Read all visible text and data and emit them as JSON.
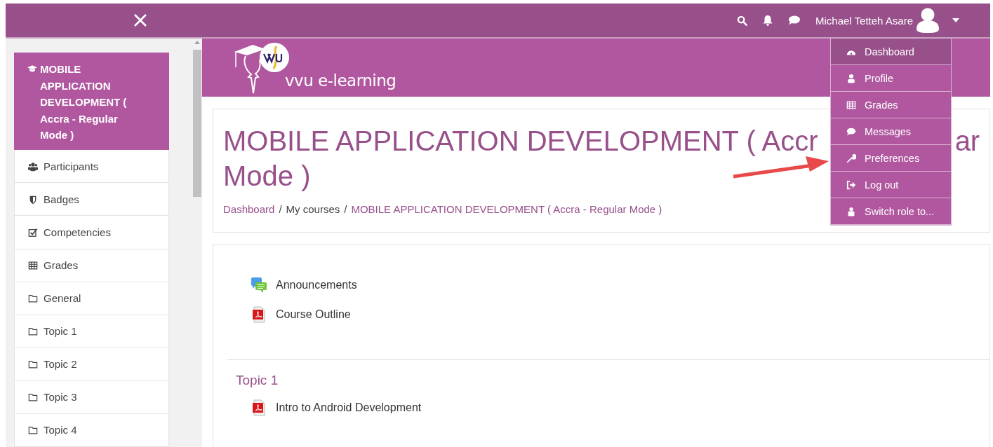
{
  "navbar": {
    "user_name": "Michael Tetteh Asare"
  },
  "user_menu": [
    {
      "label": "Dashboard",
      "kind": "dashboard",
      "selected": true
    },
    {
      "label": "Profile",
      "kind": "user",
      "selected": false
    },
    {
      "label": "Grades",
      "kind": "table",
      "selected": false
    },
    {
      "label": "Messages",
      "kind": "comment",
      "selected": false
    },
    {
      "label": "Preferences",
      "kind": "wrench",
      "selected": false
    },
    {
      "label": "Log out",
      "kind": "logout",
      "selected": false
    },
    {
      "label": "Switch role to...",
      "kind": "role",
      "selected": false
    }
  ],
  "sidebar": {
    "items": [
      {
        "label": "MOBILE APPLICATION DEVELOPMENT ( Accra - Regular Mode )",
        "kind": "course",
        "selected": true
      },
      {
        "label": "Participants",
        "kind": "users",
        "selected": false
      },
      {
        "label": "Badges",
        "kind": "shield",
        "selected": false
      },
      {
        "label": "Competencies",
        "kind": "check",
        "selected": false
      },
      {
        "label": "Grades",
        "kind": "table",
        "selected": false
      },
      {
        "label": "General",
        "kind": "folder",
        "selected": false
      },
      {
        "label": "Topic 1",
        "kind": "folder",
        "selected": false
      },
      {
        "label": "Topic 2",
        "kind": "folder",
        "selected": false
      },
      {
        "label": "Topic 3",
        "kind": "folder",
        "selected": false
      },
      {
        "label": "Topic 4",
        "kind": "folder",
        "selected": false
      }
    ]
  },
  "banner": {
    "site_name": "vvu e-learning"
  },
  "header": {
    "title_parts": [
      "MOBILE APPLICATION DEVELOPMENT ( Accr",
      "ar",
      "Mode )"
    ],
    "breadcrumb": [
      {
        "label": "Dashboard",
        "link": true,
        "separator": "/"
      },
      {
        "label": "My courses",
        "link": false,
        "separator": "/"
      },
      {
        "label": "MOBILE APPLICATION DEVELOPMENT ( Accra - Regular Mode )",
        "link": true
      }
    ]
  },
  "sections": [
    {
      "activities": [
        {
          "label": "Announcements",
          "kind": "forum"
        },
        {
          "label": "Course Outline",
          "kind": "pdf"
        }
      ]
    },
    {
      "title": "Topic 1",
      "activities": [
        {
          "label": "Intro to Android Development",
          "kind": "pdf"
        }
      ]
    }
  ]
}
